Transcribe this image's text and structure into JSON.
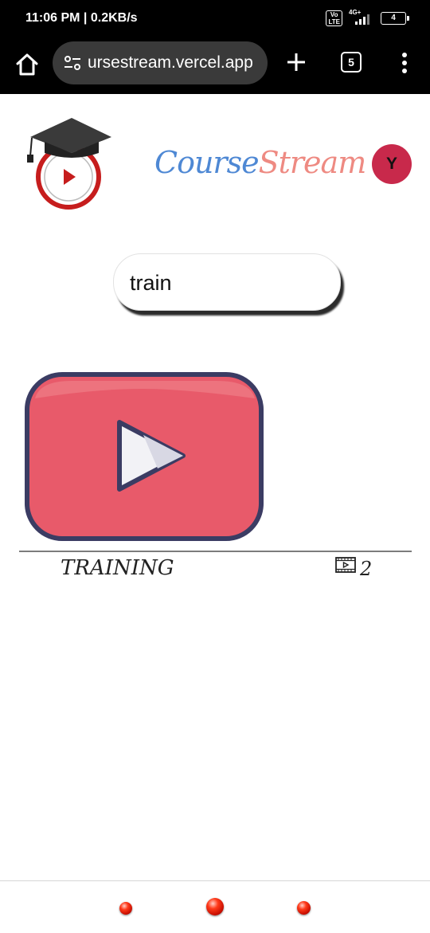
{
  "status_bar": {
    "time": "11:06 PM | 0.2KB/s",
    "volte": "Vo LTE",
    "network": "4G+",
    "battery": "4"
  },
  "browser": {
    "url": "ursestream.vercel.app",
    "tab_count": "5"
  },
  "header": {
    "brand_part1": "Course",
    "brand_part2": "Stream",
    "avatar_initial": "Y"
  },
  "search": {
    "value": "train",
    "placeholder": ""
  },
  "courses": [
    {
      "title": "TRAINING",
      "video_count": "2"
    }
  ],
  "colors": {
    "brand_blue": "#4e88d4",
    "brand_pink": "#ee8a82",
    "avatar_bg": "#c8294b",
    "thumb_red": "#e85a6a",
    "thumb_outline": "#3b3c63"
  }
}
